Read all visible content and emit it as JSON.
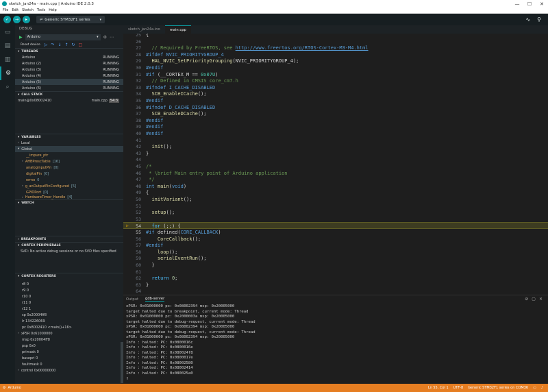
{
  "window": {
    "title": "sketch_jan24a - main.cpp | Arduino IDE 2.0.3",
    "controls": [
      "—",
      "☐",
      "✕"
    ]
  },
  "menu": [
    "File",
    "Edit",
    "Sketch",
    "Tools",
    "Help"
  ],
  "toolbar": {
    "verify_icon": "check-icon",
    "upload_icon": "arrow-right-icon",
    "debug_icon": "debug-icon",
    "board": "Generic STM32F1 series",
    "board_icon": "usb-icon",
    "serial_plotter_icon": "plotter-icon",
    "serial_monitor_icon": "monitor-icon"
  },
  "activity": [
    "folder-icon",
    "boards-icon",
    "library-icon",
    "debug-icon",
    "search-icon"
  ],
  "debug": {
    "title": "DEBUG",
    "config": "Arduino",
    "reset_label": "Reset device",
    "threads_title": "THREADS",
    "threads": [
      {
        "name": "Arduino",
        "state": "RUNNING"
      },
      {
        "name": "Arduino (2)",
        "state": "RUNNING"
      },
      {
        "name": "Arduino (3)",
        "state": "RUNNING"
      },
      {
        "name": "Arduino (4)",
        "state": "RUNNING"
      },
      {
        "name": "Arduino (5)",
        "state": "RUNNING"
      },
      {
        "name": "Arduino (6)",
        "state": "RUNNING"
      }
    ],
    "callstack_title": "CALL STACK",
    "callstack": [
      {
        "frame": "main@0x08002410",
        "file": "main.cpp",
        "line": "54:3"
      }
    ],
    "variables_title": "VARIABLES",
    "variables": {
      "local": "Local",
      "global": "Global",
      "items": [
        {
          "name": "__impure_ptr",
          "value": ""
        },
        {
          "name": "AHBPrescTable",
          "value": "[16]",
          "expandable": true
        },
        {
          "name": "analogInputPin",
          "value": "[0]"
        },
        {
          "name": "digitalPin",
          "value": "[0]"
        },
        {
          "name": "errno",
          "value": "0"
        },
        {
          "name": "g_anOutputPinConfigured",
          "value": "[5]",
          "expandable": true
        },
        {
          "name": "GPIOPort",
          "value": "[0]"
        },
        {
          "name": "HardwareTimer_Handle",
          "value": "[4]",
          "expandable": true
        }
      ]
    },
    "watch_title": "WATCH",
    "breakpoints_title": "BREAKPOINTS",
    "peripherals_title": "CORTEX PERIPHERALS",
    "peripherals_msg": "SVD: No active debug sessions or no SVD files specified",
    "registers_title": "CORTEX REGISTERS",
    "registers": [
      "r8 0",
      "r9 0",
      "r10 0",
      "r11 0",
      "r12 1",
      "sp 0x20004ff8",
      "lr 134226069",
      "pc 0x8002410 <main()+16>",
      "xPSR 0x61000000",
      "msp 0x20004ff8",
      "psp 0x0",
      "primask 0",
      "basepri 0",
      "faultmask 0",
      "control 0x00000000"
    ]
  },
  "tabs": [
    {
      "label": "sketch_jan24a.ino",
      "active": false
    },
    {
      "label": "main.cpp",
      "active": true
    }
  ],
  "code": [
    {
      "n": "25",
      "t": "{"
    },
    {
      "n": "26",
      "t": ""
    },
    {
      "n": "27",
      "t": "  // Required by FreeRTOS, see http://www.freertos.org/RTOS-Cortex-M3-M4.html"
    },
    {
      "n": "28",
      "t": "#ifdef NVIC_PRIORITYGROUP_4"
    },
    {
      "n": "29",
      "t": "  HAL_NVIC_SetPriorityGrouping(NVIC_PRIORITYGROUP_4);"
    },
    {
      "n": "30",
      "t": "#endif"
    },
    {
      "n": "31",
      "t": "#if (__CORTEX_M == 0x07U)"
    },
    {
      "n": "32",
      "t": "  // Defined in CMSIS core_cm7.h"
    },
    {
      "n": "33",
      "t": "#ifndef I_CACHE_DISABLED"
    },
    {
      "n": "34",
      "t": "  SCB_EnableICache();"
    },
    {
      "n": "35",
      "t": "#endif"
    },
    {
      "n": "36",
      "t": "#ifndef D_CACHE_DISABLED"
    },
    {
      "n": "37",
      "t": "  SCB_EnableDCache();"
    },
    {
      "n": "38",
      "t": "#endif"
    },
    {
      "n": "39",
      "t": "#endif"
    },
    {
      "n": "40",
      "t": "#endif"
    },
    {
      "n": "41",
      "t": ""
    },
    {
      "n": "42",
      "t": "  init();"
    },
    {
      "n": "43",
      "t": "}"
    },
    {
      "n": "44",
      "t": ""
    },
    {
      "n": "45",
      "t": "/*"
    },
    {
      "n": "46",
      "t": " * \\brief Main entry point of Arduino application"
    },
    {
      "n": "47",
      "t": " */"
    },
    {
      "n": "48",
      "t": "int main(void)"
    },
    {
      "n": "49",
      "t": "{"
    },
    {
      "n": "50",
      "t": "  initVariant();"
    },
    {
      "n": "51",
      "t": ""
    },
    {
      "n": "52",
      "t": "  setup();"
    },
    {
      "n": "53",
      "t": ""
    },
    {
      "n": "54",
      "t": "  for (;;) {"
    },
    {
      "n": "55",
      "t": "#if defined(CORE_CALLBACK)"
    },
    {
      "n": "56",
      "t": "    CoreCallback();"
    },
    {
      "n": "57",
      "t": "#endif"
    },
    {
      "n": "58",
      "t": "    loop();"
    },
    {
      "n": "59",
      "t": "    serialEventRun();"
    },
    {
      "n": "60",
      "t": "  }"
    },
    {
      "n": "61",
      "t": ""
    },
    {
      "n": "62",
      "t": "  return 0;"
    },
    {
      "n": "63",
      "t": "}"
    },
    {
      "n": "64",
      "t": ""
    }
  ],
  "output": {
    "tabs": [
      "Output",
      "gdb-server"
    ],
    "lines": [
      "xPSR: 0x01000000 pc: 0x08002394 msp: 0x20005000",
      "target halted due to breakpoint, current mode: Thread",
      "xPSR: 0x01000000 pc: 0x2000003a msp: 0x20005000",
      "target halted due to debug-request, current mode: Thread",
      "xPSR: 0x01000000 pc: 0x08002394 msp: 0x20005000",
      "target halted due to debug-request, current mode: Thread",
      "xPSR: 0x01000000 pc: 0x08002394 msp: 0x20005000",
      "Info : halted: PC: 0x0800016c",
      "Info : halted: PC: 0x0800016e",
      "Info : halted: PC: 0x080024f8",
      "Info : halted: PC: 0x0800017e",
      "Info : halted: PC: 0x08002580",
      "Info : halted: PC: 0x08002414",
      "Info : halted: PC: 0x080025a0",
      "▯"
    ]
  },
  "status": {
    "left": "Arduino",
    "position": "Ln 55, Col 1",
    "encoding": "UTF-8",
    "board": "Generic STM32F1 series on COM36"
  },
  "colors": {
    "accent": "#0ca1a6",
    "status_debug": "#e67e22",
    "highlight_line": "#3d3c21"
  }
}
